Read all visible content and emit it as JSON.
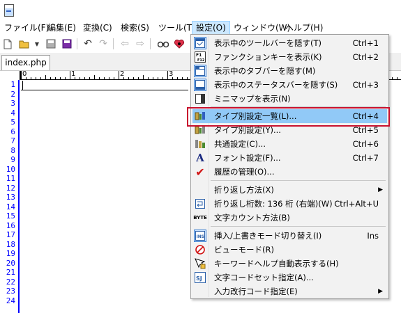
{
  "menubar": {
    "items": [
      "ファイル(F)",
      "編集(E)",
      "変換(C)",
      "検索(S)",
      "ツール(T)",
      "設定(O)",
      "ウィンドウ(W)",
      "ヘルプ(H)"
    ]
  },
  "tab": {
    "label": "index.php"
  },
  "ruler": {
    "labels": [
      "0",
      "1",
      "2",
      "3"
    ]
  },
  "line_numbers": [
    "1",
    "2",
    "3",
    "4",
    "5",
    "6",
    "7",
    "8",
    "9",
    "10",
    "11",
    "12",
    "13",
    "14",
    "15",
    "16",
    "17",
    "18",
    "19",
    "20",
    "21",
    "22",
    "23",
    "24"
  ],
  "settings_menu": {
    "items": [
      {
        "label": "表示中のツールバーを隠す(T)",
        "shortcut": "Ctrl+1",
        "icon": "toolbar-toggle-icon"
      },
      {
        "label": "ファンクションキーを表示(K)",
        "shortcut": "Ctrl+2",
        "icon": "function-keys-icon"
      },
      {
        "label": "表示中のタブバーを隠す(M)",
        "shortcut": "",
        "icon": "tabbar-toggle-icon"
      },
      {
        "label": "表示中のステータスバーを隠す(S)",
        "shortcut": "Ctrl+3",
        "icon": "statusbar-toggle-icon"
      },
      {
        "label": "ミニマップを表示(N)",
        "shortcut": "",
        "icon": "minimap-icon"
      },
      {
        "label": "タイプ別設定一覧(L)...",
        "shortcut": "Ctrl+4",
        "icon": "type-settings-list-icon"
      },
      {
        "label": "タイプ別設定(Y)...",
        "shortcut": "Ctrl+5",
        "icon": "type-settings-icon"
      },
      {
        "label": "共通設定(C)...",
        "shortcut": "Ctrl+6",
        "icon": "common-settings-icon"
      },
      {
        "label": "フォント設定(F)...",
        "shortcut": "Ctrl+7",
        "icon": "font-icon"
      },
      {
        "label": "履歴の管理(O)...",
        "shortcut": "",
        "icon": "checkmark-icon"
      },
      {
        "label": "折り返し方法(X)",
        "shortcut": "",
        "icon": ""
      },
      {
        "label": "折り返し桁数: 136 桁 (右端)(W)",
        "shortcut": "Ctrl+Alt+U",
        "icon": "wrap-icon"
      },
      {
        "label": "文字カウント方法(B)",
        "shortcut": "",
        "icon": "byte-icon"
      },
      {
        "label": "挿入/上書きモード切り替え(I)",
        "shortcut": "Ins",
        "icon": "insert-mode-icon"
      },
      {
        "label": "ビューモード(R)",
        "shortcut": "",
        "icon": "view-mode-icon"
      },
      {
        "label": "キーワードヘルプ自動表示する(H)",
        "shortcut": "",
        "icon": "keyword-help-icon"
      },
      {
        "label": "文字コードセット指定(A)...",
        "shortcut": "",
        "icon": "charset-icon"
      },
      {
        "label": "入力改行コード指定(E)",
        "shortcut": "",
        "icon": ""
      }
    ]
  },
  "icons": {
    "byte_text": "BYTE",
    "ins_text": "INS",
    "f1_text": "F1",
    "sj_text": "SJ",
    "font_glyph": "A",
    "check_glyph": "✔"
  }
}
